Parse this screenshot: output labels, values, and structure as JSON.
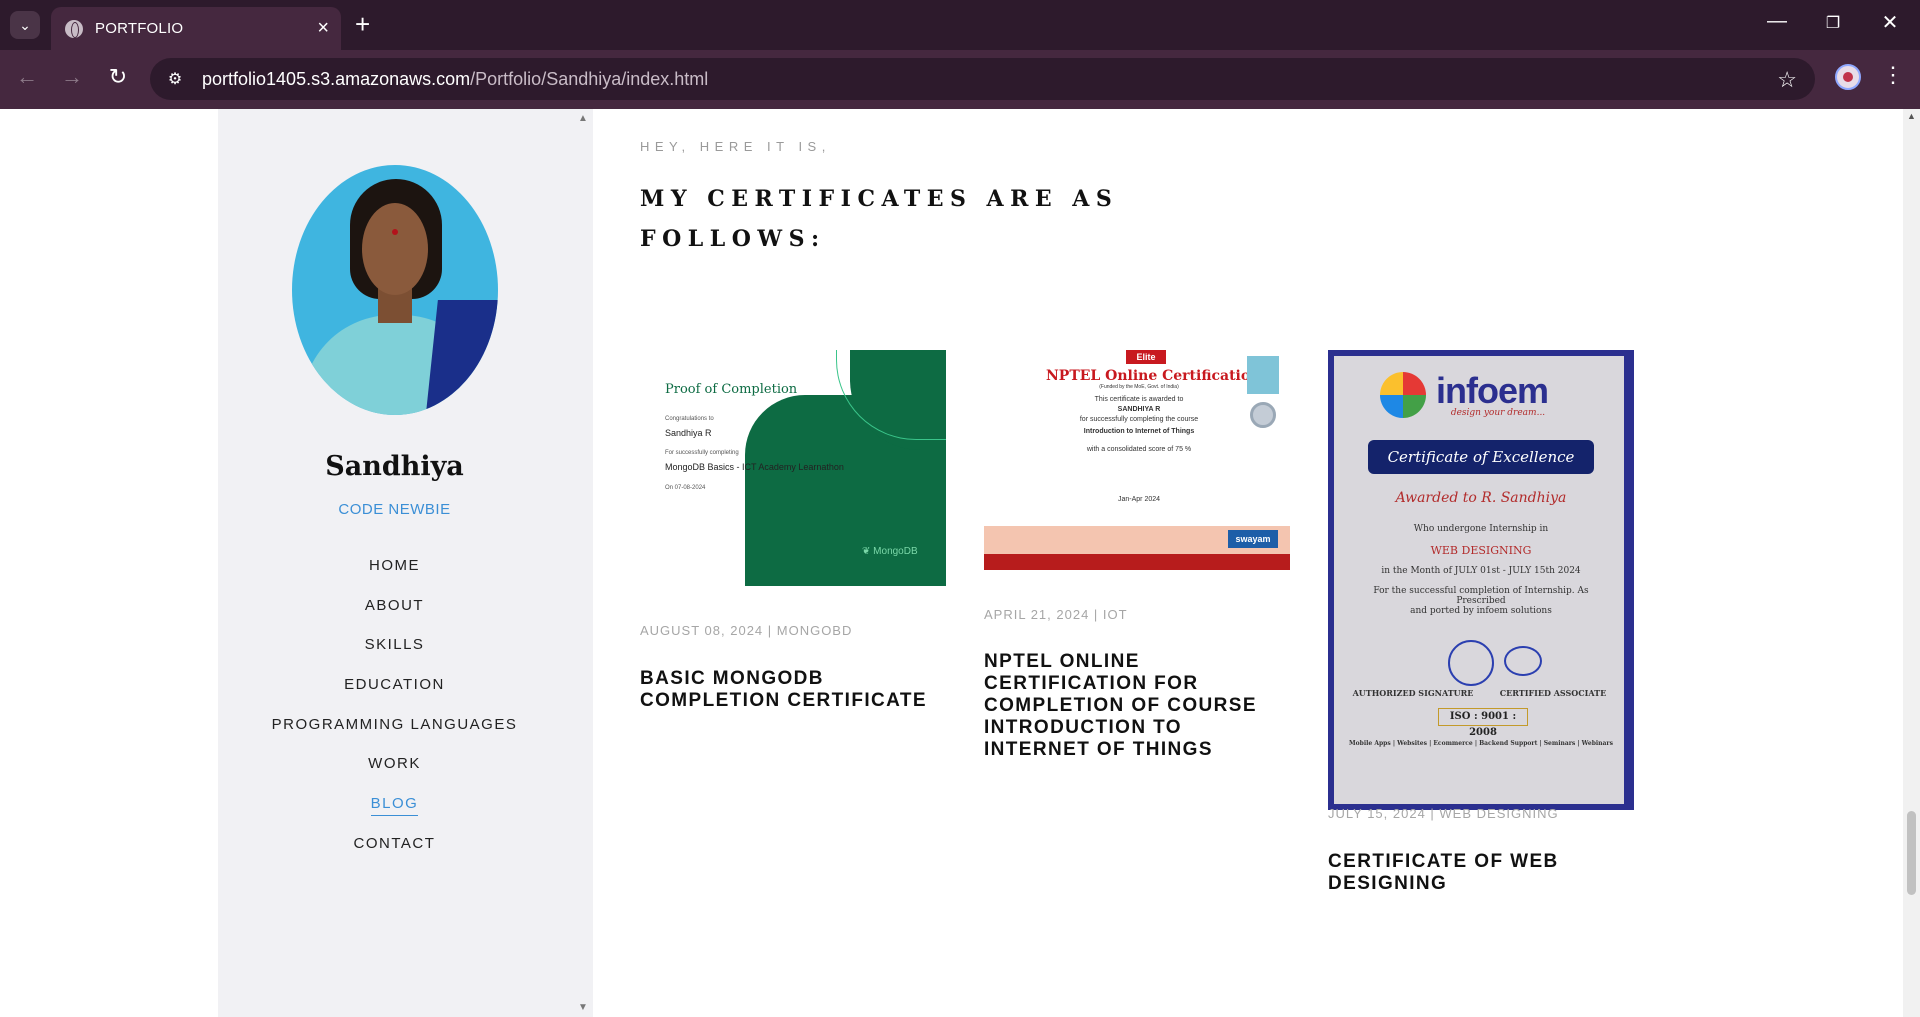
{
  "browser": {
    "tab_title": "PORTFOLIO",
    "url_host": "portfolio1405.s3.amazonaws.com",
    "url_path": "/Portfolio/Sandhiya/index.html"
  },
  "sidebar": {
    "name": "Sandhiya",
    "role": "CODE NEWBIE",
    "nav": [
      "HOME",
      "ABOUT",
      "SKILLS",
      "EDUCATION",
      "PROGRAMMING LANGUAGES",
      "WORK",
      "BLOG",
      "CONTACT"
    ],
    "active_item": "BLOG"
  },
  "intro": {
    "small": "HEY, HERE IT IS,",
    "title": "MY CERTIFICATES ARE AS FOLLOWS:"
  },
  "certificates": [
    {
      "meta": "AUGUST 08, 2024 | MONGOBD",
      "title": "BASIC MONGODB COMPLETION CERTIFICATE",
      "img": {
        "heading": "Proof of Completion",
        "congrats": "Congratulations to",
        "recipient": "Sandhiya R",
        "for": "For successfully completing",
        "course": "MongoDB Basics - ICT Academy Learnathon",
        "date": "On 07-08-2024",
        "brand": "MongoDB"
      }
    },
    {
      "meta": "APRIL 21, 2024 | IOT",
      "title": "NPTEL ONLINE CERTIFICATION FOR COMPLETION OF COURSE INTRODUCTION TO INTERNET OF THINGS",
      "img": {
        "ribbon": "Elite",
        "heading": "NPTEL Online Certification",
        "funded": "(Funded by the MoE, Govt. of India)",
        "awarded": "This certificate is awarded to",
        "recipient": "SANDHIYA R",
        "for": "for successfully completing the course",
        "course": "Introduction to Internet of Things",
        "score": "with a consolidated score of 75 %",
        "period": "Jan-Apr 2024",
        "swayam": "swayam"
      }
    },
    {
      "meta": "JULY 15, 2024 | WEB DESIGNING",
      "title": "CERTIFICATE OF WEB DESIGNING",
      "img": {
        "brand": "infoem",
        "tagline": "design your dream...",
        "banner": "Certificate of Excellence",
        "awarded": "Awarded to R. Sandhiya",
        "intern": "Who undergone Internship in",
        "field": "WEB DESIGNING",
        "month": "in the Month of JULY 01st - JULY 15th 2024",
        "completion": "For the successful completion of Internship. As Prescribed",
        "provider": "and ported by infoem solutions",
        "sig1": "AUTHORIZED SIGNATURE",
        "sig2": "CERTIFIED ASSOCIATE",
        "iso": "ISO : 9001 : 2008",
        "services": "Mobile Apps | Websites | Ecommerce | Backend Support | Seminars | Webinars"
      }
    }
  ]
}
